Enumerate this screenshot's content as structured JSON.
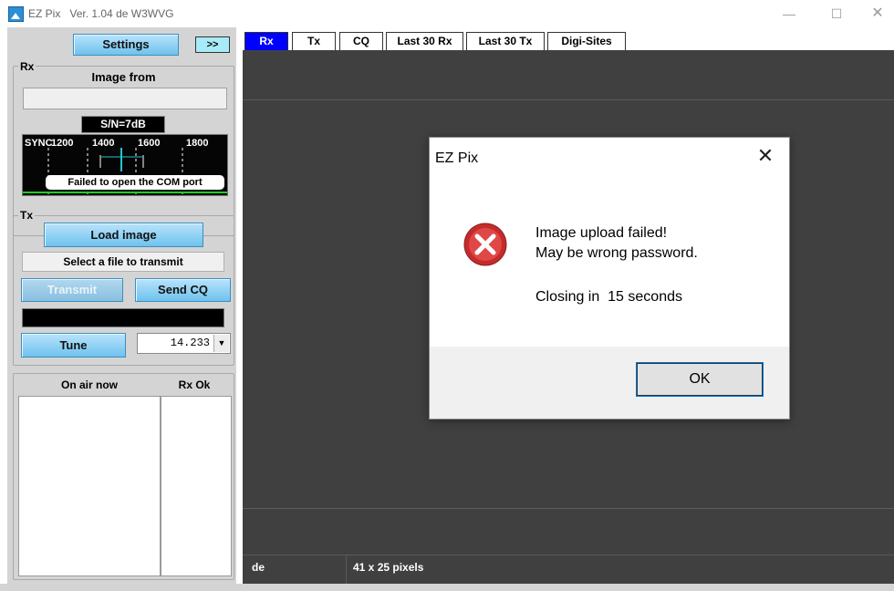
{
  "window": {
    "app_name": "EZ Pix",
    "version": "Ver. 1.04 de W3WVG"
  },
  "left": {
    "settings_label": "Settings",
    "expand_label": ">>",
    "rx_group": "Rx",
    "image_from_label": "Image from",
    "image_from_value": "",
    "snr": "S/N=7dB",
    "waterfall": {
      "sync_label": "SYNC",
      "ticks": [
        "1200",
        "1400",
        "1600",
        "1800"
      ],
      "error": "Failed to open the COM port"
    },
    "tx_group": "Tx",
    "load_image_label": "Load image",
    "select_file_label": "Select a file to transmit",
    "transmit_label": "Transmit",
    "send_cq_label": "Send CQ",
    "tune_label": "Tune",
    "frequency": "14.233",
    "on_air_header": "On air now",
    "rx_ok_header": "Rx Ok"
  },
  "tabs": [
    {
      "label": "Rx",
      "active": true
    },
    {
      "label": "Tx"
    },
    {
      "label": "CQ"
    },
    {
      "label": "Last 30 Rx"
    },
    {
      "label": "Last 30 Tx"
    },
    {
      "label": "Digi-Sites"
    }
  ],
  "status": {
    "callsign": "de",
    "size": "41 x 25 pixels"
  },
  "dialog": {
    "title": "EZ Pix",
    "line1": "Image upload failed!",
    "line2": "May be wrong password.",
    "countdown": "Closing in  15 seconds",
    "ok_label": "OK"
  },
  "colors": {
    "button_blue": "#6ec2ee",
    "active_tab": "#0000ff",
    "error_red": "#d83b3b"
  }
}
